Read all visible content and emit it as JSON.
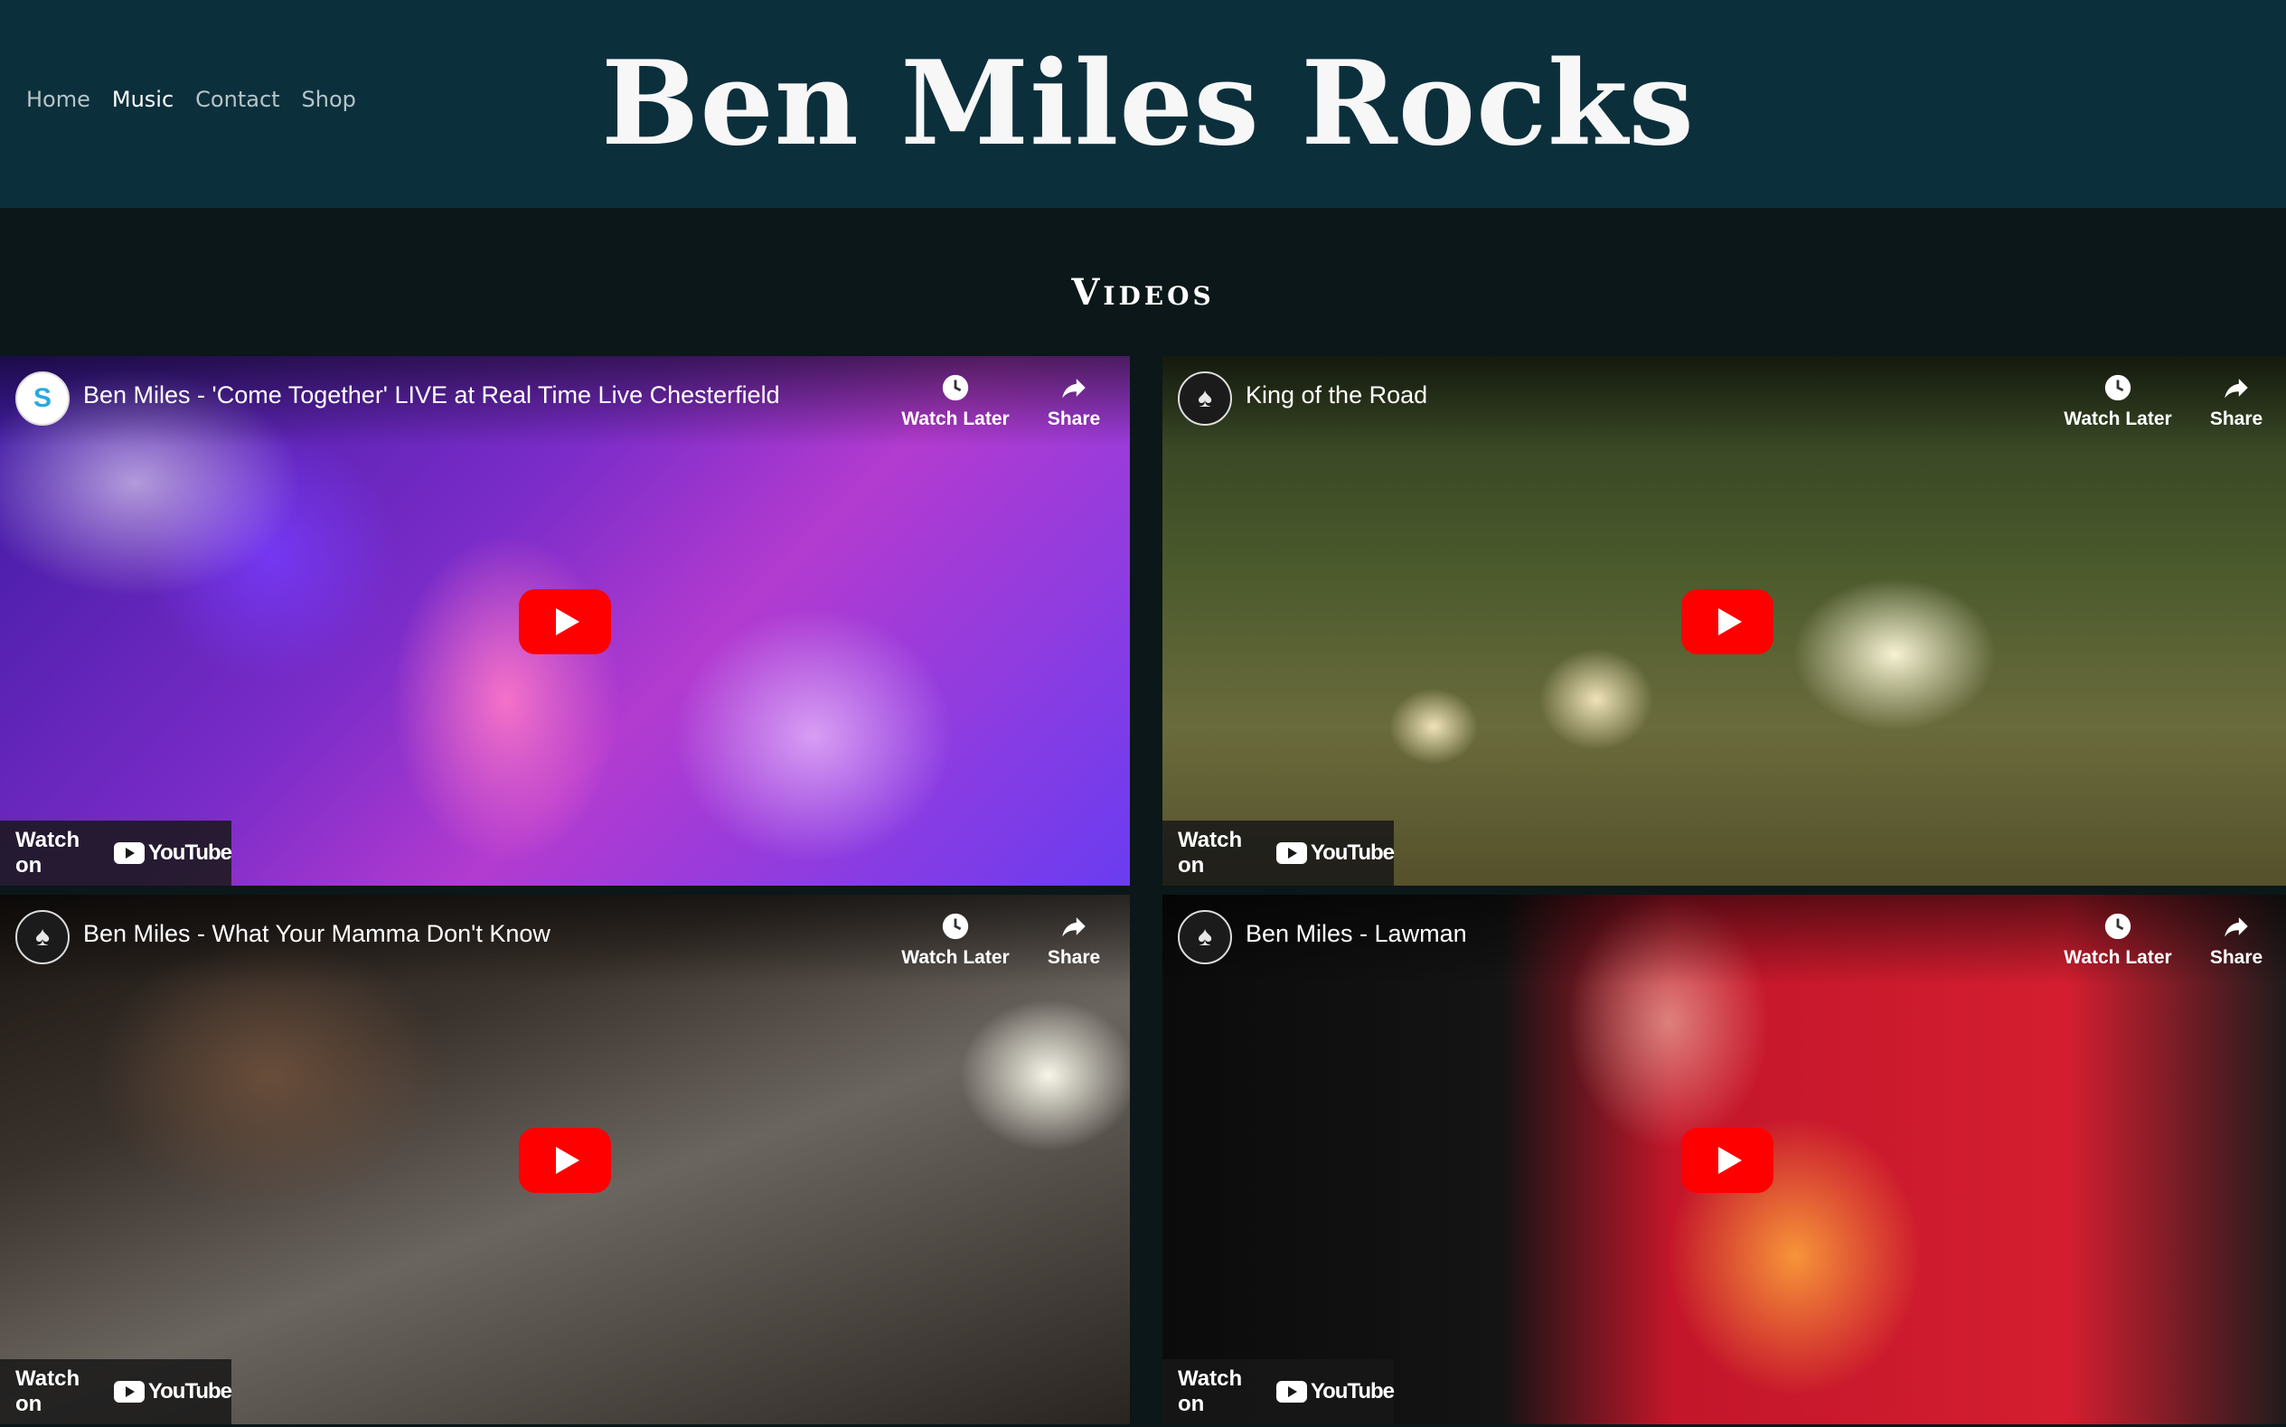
{
  "nav": {
    "items": [
      {
        "label": "Home",
        "active": false
      },
      {
        "label": "Music",
        "active": true
      },
      {
        "label": "Contact",
        "active": false
      },
      {
        "label": "Shop",
        "active": false
      }
    ]
  },
  "site": {
    "title": "Ben Miles Rocks"
  },
  "section": {
    "title": "Videos"
  },
  "videos": [
    {
      "title": "Ben Miles - 'Come Together' LIVE at Real Time Live Chesterfield",
      "channel_icon": "s-logo-icon",
      "watch_later": "Watch Later",
      "share": "Share",
      "watch_on": "Watch on",
      "platform": "YouTube"
    },
    {
      "title": "King of the Road",
      "channel_icon": "guitar-avatar-icon",
      "watch_later": "Watch Later",
      "share": "Share",
      "watch_on": "Watch on",
      "platform": "YouTube"
    },
    {
      "title": "Ben Miles - What Your Mamma Don't Know",
      "channel_icon": "guitar-avatar-icon",
      "watch_later": "Watch Later",
      "share": "Share",
      "watch_on": "Watch on",
      "platform": "YouTube"
    },
    {
      "title": "Ben Miles - Lawman",
      "channel_icon": "guitar-avatar-icon",
      "watch_later": "Watch Later",
      "share": "Share",
      "watch_on": "Watch on",
      "platform": "YouTube"
    }
  ],
  "colors": {
    "header_bg": "#0c2f3c",
    "page_bg": "#0b1718",
    "play_red": "#ff0000"
  }
}
